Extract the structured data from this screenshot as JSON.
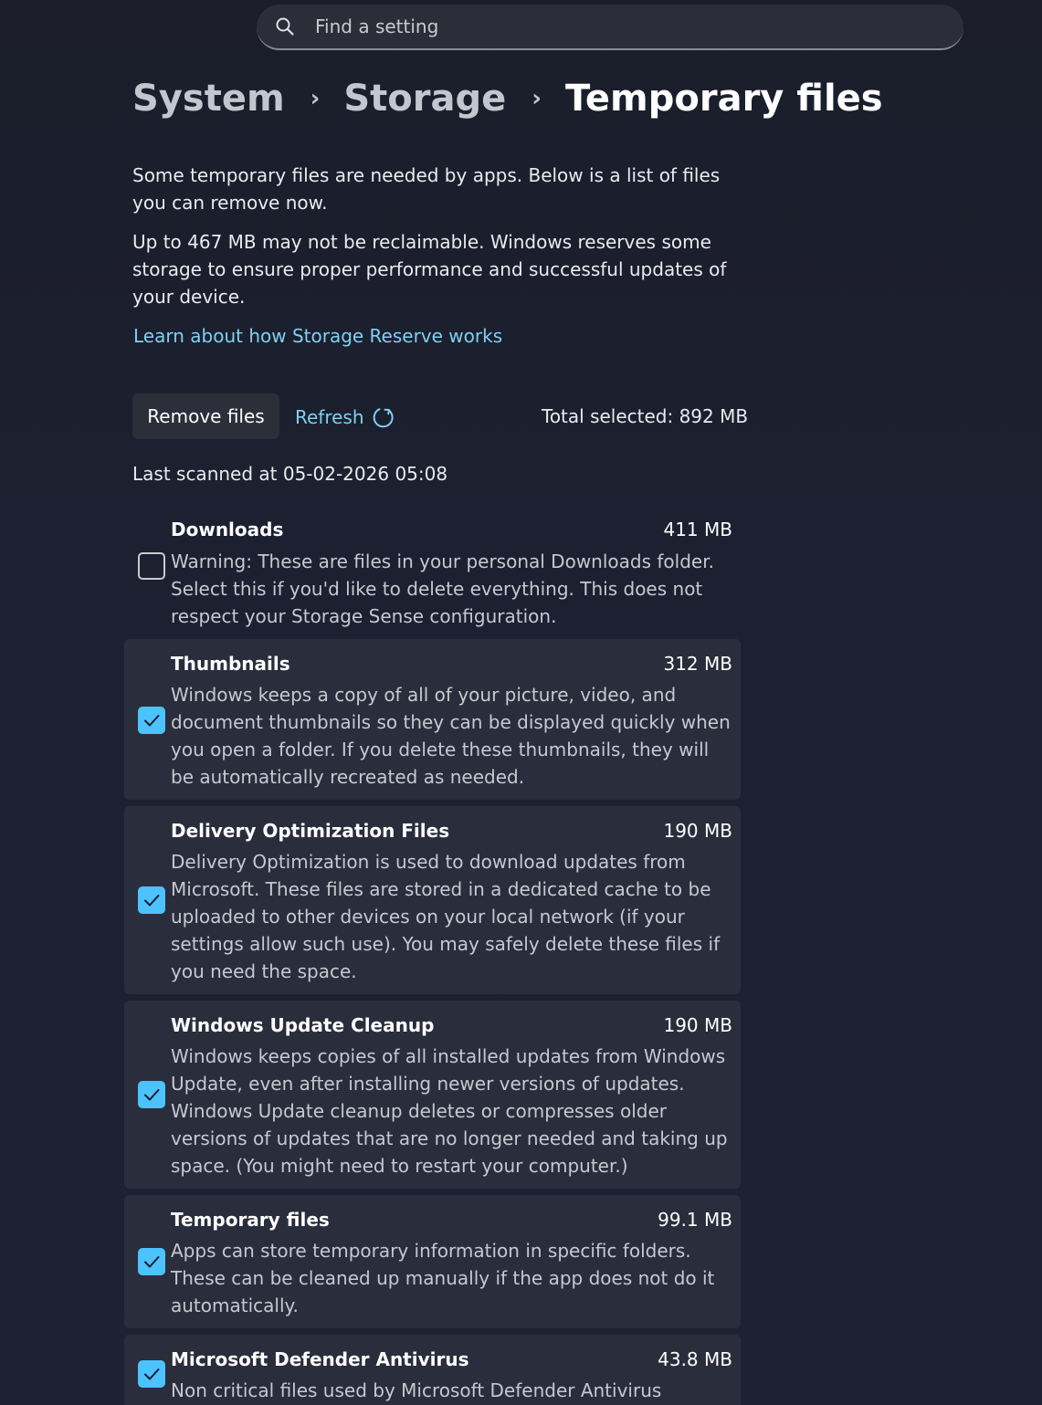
{
  "search": {
    "placeholder": "Find a setting",
    "icon": "search-icon"
  },
  "breadcrumb": {
    "items": [
      "System",
      "Storage"
    ],
    "current": "Temporary files",
    "separator": "›"
  },
  "intro": {
    "p1": "Some temporary files are needed by apps. Below is a list of files you can remove now.",
    "p2": "Up to 467 MB may not be reclaimable. Windows reserves some storage to ensure proper performance and successful updates of your device.",
    "link": "Learn about how Storage Reserve works"
  },
  "actions": {
    "remove_label": "Remove files",
    "refresh_label": "Refresh",
    "total_selected": "Total selected: 892 MB",
    "last_scanned": "Last scanned at 05-02-2026 05:08"
  },
  "colors": {
    "accent": "#4cc2ff",
    "link": "#7fd0f0",
    "card": "#2a2d3c"
  },
  "items": [
    {
      "title": "Downloads",
      "size": "411 MB",
      "checked": false,
      "description": "Warning: These are files in your personal Downloads folder. Select this if you'd like to delete everything. This does not respect your Storage Sense configuration."
    },
    {
      "title": "Thumbnails",
      "size": "312 MB",
      "checked": true,
      "description": "Windows keeps a copy of all of your picture, video, and document thumbnails so they can be displayed quickly when you open a folder. If you delete these thumbnails, they will be automatically recreated as needed."
    },
    {
      "title": "Delivery Optimization Files",
      "size": "190 MB",
      "checked": true,
      "description": "Delivery Optimization is used to download updates from Microsoft. These files are stored in a dedicated cache to be uploaded to other devices on your local network (if your settings allow such use). You may safely delete these files if you need the space."
    },
    {
      "title": "Windows Update Cleanup",
      "size": "190 MB",
      "checked": true,
      "description": "Windows keeps copies of all installed updates from Windows Update, even after installing newer versions of updates. Windows Update cleanup deletes or compresses older versions of updates that are no longer needed and taking up space. (You might need to restart your computer.)"
    },
    {
      "title": "Temporary files",
      "size": "99.1 MB",
      "checked": true,
      "description": "Apps can store temporary information in specific folders. These can be cleaned up manually if the app does not do it automatically."
    },
    {
      "title": "Microsoft Defender Antivirus",
      "size": "43.8 MB",
      "checked": true,
      "description": "Non critical files used by Microsoft Defender Antivirus"
    }
  ]
}
